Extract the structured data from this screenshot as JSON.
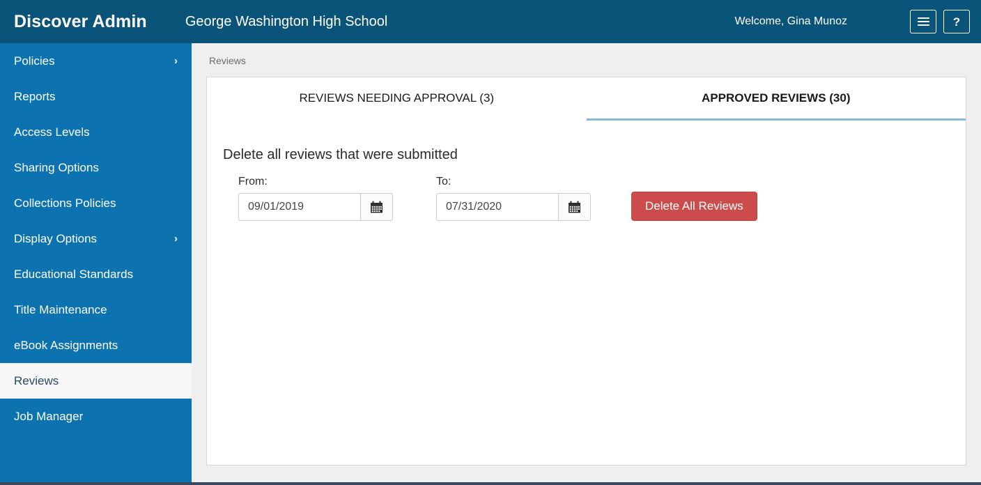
{
  "header": {
    "brand": "Discover Admin",
    "school": "George Washington High School",
    "welcome": "Welcome, Gina Munoz",
    "menu_icon": "hamburger-menu-icon",
    "help_label": "?"
  },
  "sidebar": {
    "items": [
      {
        "label": "Policies",
        "chevron": "›",
        "active": false
      },
      {
        "label": "Reports",
        "chevron": "",
        "active": false
      },
      {
        "label": "Access Levels",
        "chevron": "",
        "active": false
      },
      {
        "label": "Sharing Options",
        "chevron": "",
        "active": false
      },
      {
        "label": "Collections Policies",
        "chevron": "",
        "active": false
      },
      {
        "label": "Display Options",
        "chevron": "›",
        "active": false
      },
      {
        "label": "Educational Standards",
        "chevron": "",
        "active": false
      },
      {
        "label": "Title Maintenance",
        "chevron": "",
        "active": false
      },
      {
        "label": "eBook Assignments",
        "chevron": "",
        "active": false
      },
      {
        "label": "Reviews",
        "chevron": "",
        "active": true
      },
      {
        "label": "Job Manager",
        "chevron": "",
        "active": false
      }
    ]
  },
  "main": {
    "breadcrumb": "Reviews",
    "tabs": [
      {
        "label": "REVIEWS NEEDING APPROVAL (3)",
        "active": false
      },
      {
        "label": "APPROVED REVIEWS (30)",
        "active": true
      }
    ],
    "panel": {
      "title": "Delete all reviews that were submitted",
      "from_label": "From:",
      "from_value": "09/01/2019",
      "to_label": "To:",
      "to_value": "07/31/2020",
      "delete_button": "Delete All Reviews"
    }
  },
  "colors": {
    "header_blue": "#0a5379",
    "sidebar_blue": "#0c72b0",
    "active_tab_underline": "#8cb9d9",
    "danger_red": "#cc4b4b",
    "page_bg": "#efefef"
  }
}
